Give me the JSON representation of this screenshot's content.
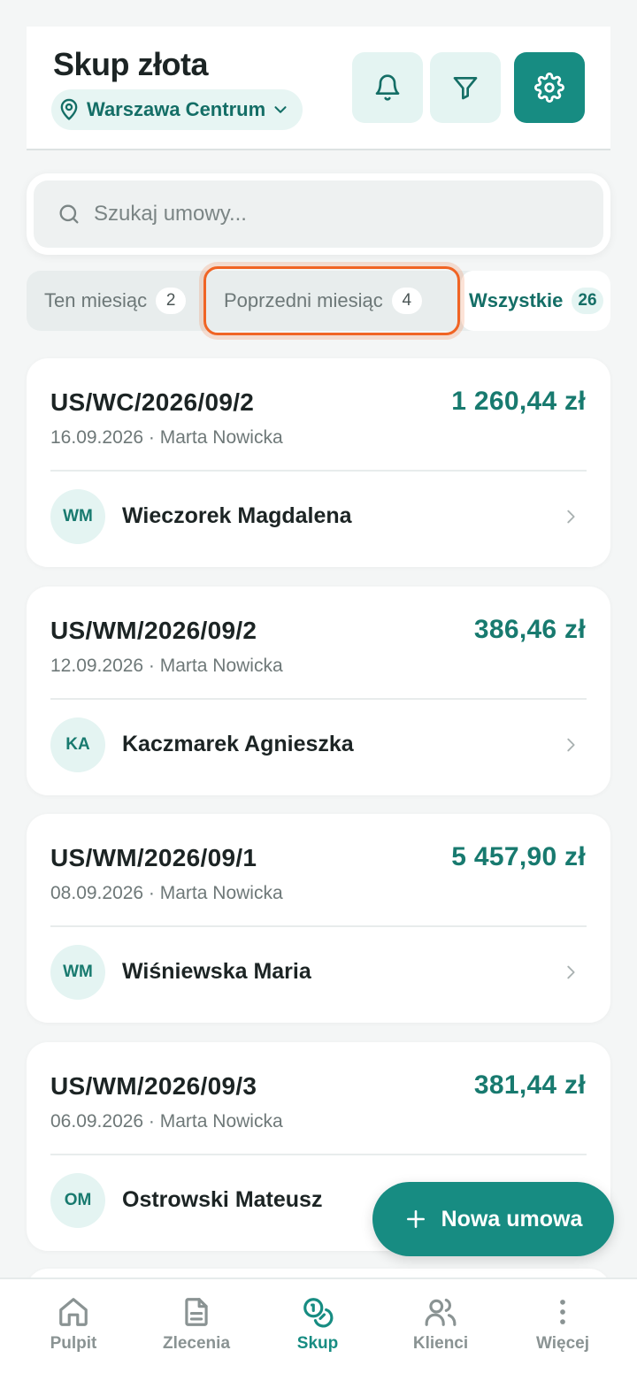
{
  "colors": {
    "accent": "#178c82",
    "accent_dark": "#146e66",
    "highlight": "#f06424"
  },
  "header": {
    "title": "Skup złota",
    "location": "Warszawa Centrum",
    "icons": [
      "bell-icon",
      "filter-icon",
      "gear-icon"
    ]
  },
  "search": {
    "placeholder": "Szukaj umowy..."
  },
  "tabs": [
    {
      "label": "Ten miesiąc",
      "count": "2"
    },
    {
      "label": "Poprzedni miesiąc",
      "count": "4",
      "highlighted": true
    },
    {
      "label": "Wszystkie",
      "count": "26",
      "selected": true
    }
  ],
  "contracts": [
    {
      "number": "US/WC/2026/09/2",
      "amount": "1 260,44 zł",
      "meta": "16.09.2026 · Marta Nowicka",
      "initials": "WM",
      "client": "Wieczorek Magdalena"
    },
    {
      "number": "US/WM/2026/09/2",
      "amount": "386,46 zł",
      "meta": "12.09.2026 · Marta Nowicka",
      "initials": "KA",
      "client": "Kaczmarek Agnieszka"
    },
    {
      "number": "US/WM/2026/09/1",
      "amount": "5 457,90 zł",
      "meta": "08.09.2026 · Marta Nowicka",
      "initials": "WM",
      "client": "Wiśniewska Maria"
    },
    {
      "number": "US/WM/2026/09/3",
      "amount": "381,44 zł",
      "meta": "06.09.2026 · Marta Nowicka",
      "initials": "OM",
      "client": "Ostrowski Mateusz"
    }
  ],
  "fab": {
    "label": "Nowa umowa"
  },
  "nav": [
    {
      "label": "Pulpit",
      "icon": "home-icon"
    },
    {
      "label": "Zlecenia",
      "icon": "document-icon"
    },
    {
      "label": "Skup",
      "icon": "coins-icon",
      "active": true
    },
    {
      "label": "Klienci",
      "icon": "users-icon"
    },
    {
      "label": "Więcej",
      "icon": "more-vertical-icon"
    }
  ]
}
